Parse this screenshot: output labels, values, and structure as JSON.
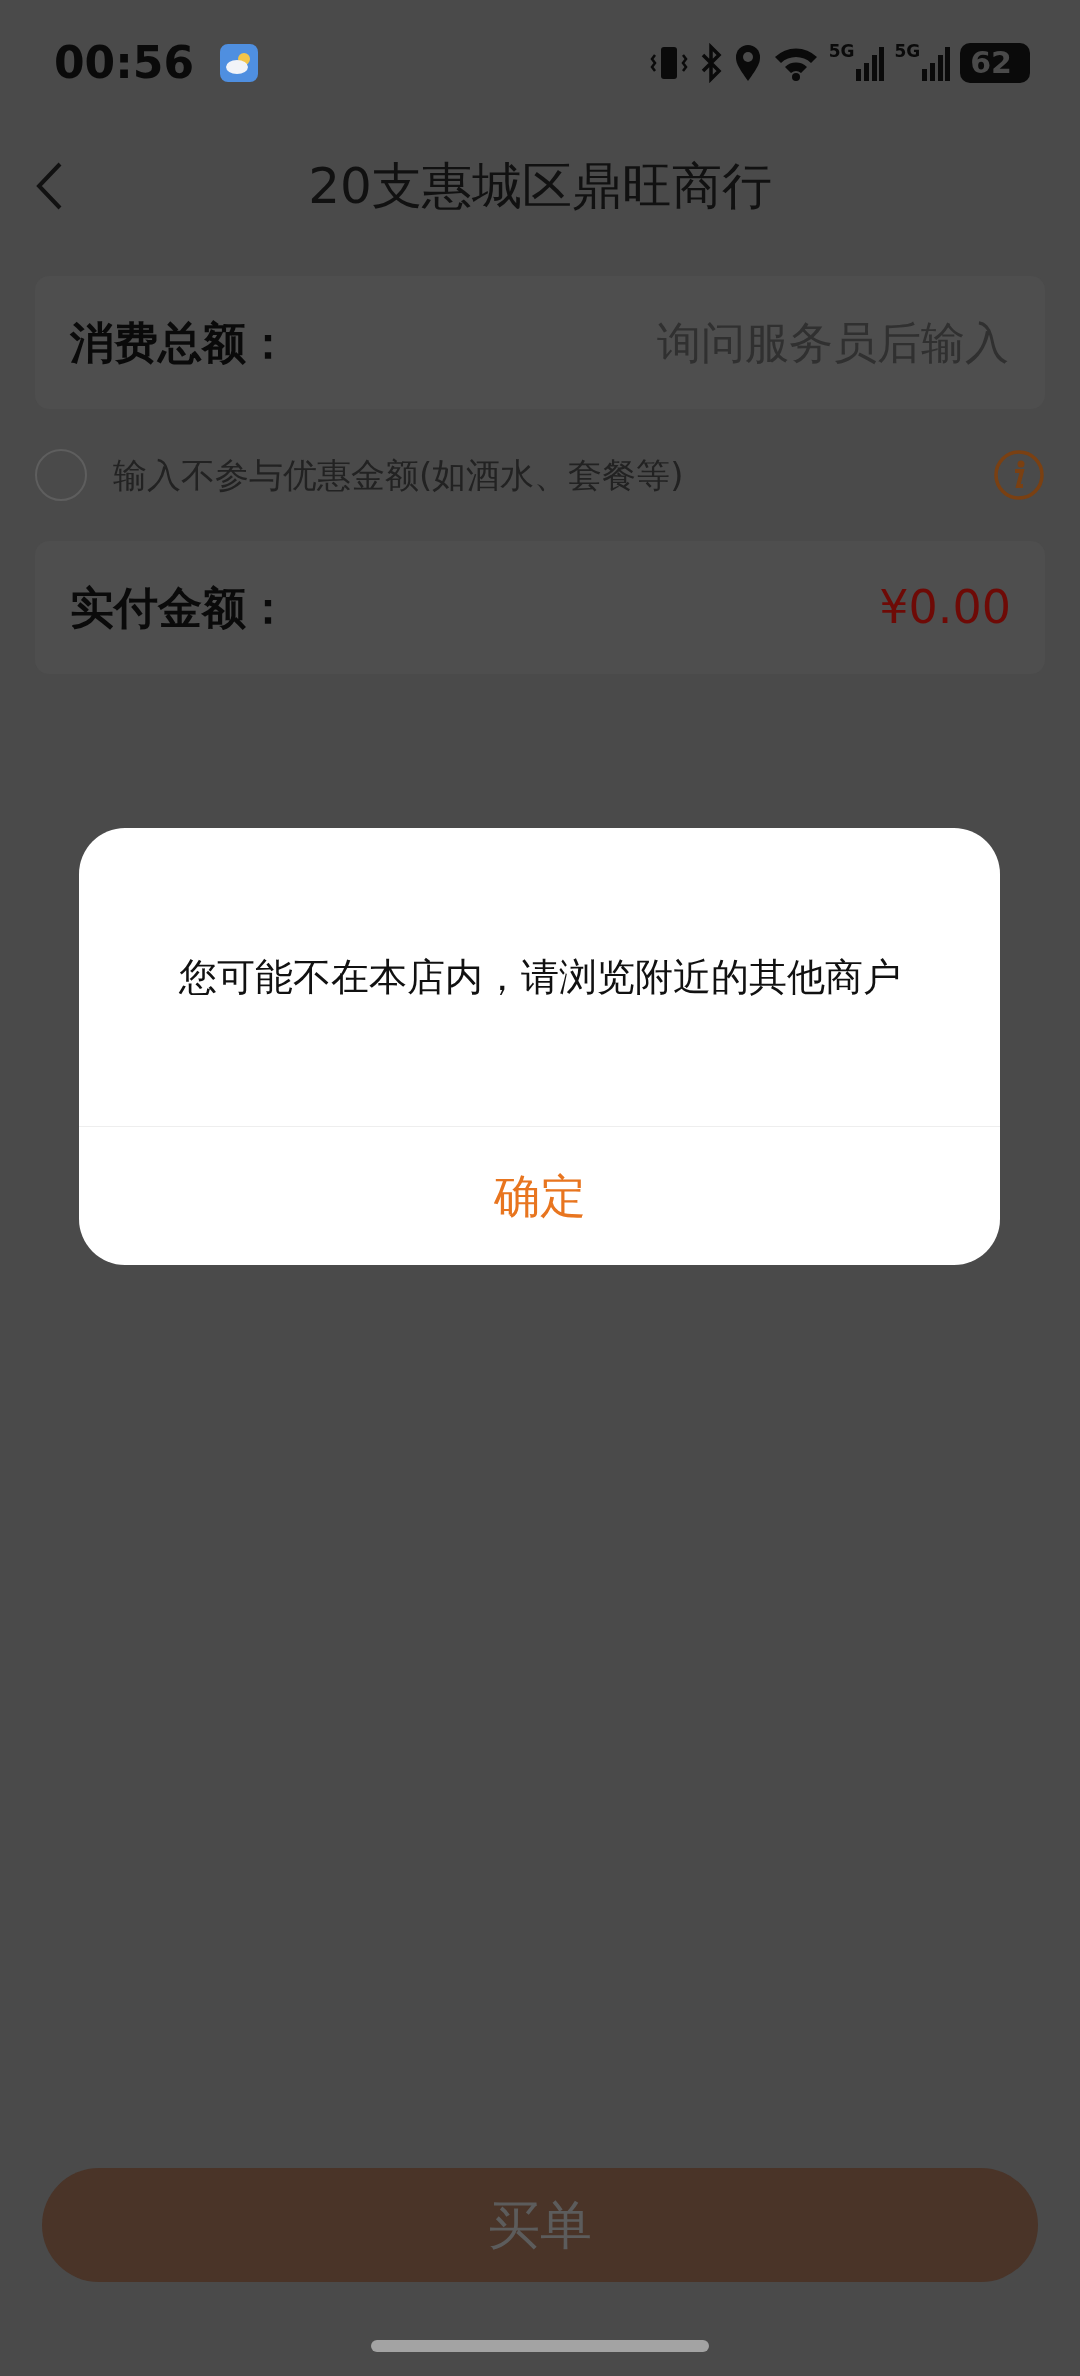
{
  "status_bar": {
    "time": "00:56",
    "network_labels": [
      "5G",
      "5G"
    ],
    "battery": "62"
  },
  "nav": {
    "title": "20支惠城区鼎旺商行"
  },
  "total_field": {
    "label": "消费总额：",
    "placeholder": "询问服务员后输入"
  },
  "exclude_option": {
    "label": "输入不参与优惠金额(如酒水、套餐等)",
    "checked": false
  },
  "payable": {
    "label": "实付金额：",
    "amount": "¥0.00"
  },
  "dialog": {
    "message": "您可能不在本店内，请浏览附近的其他商户",
    "button": "确定"
  },
  "pay_button": {
    "label": "买单",
    "disabled": true
  }
}
